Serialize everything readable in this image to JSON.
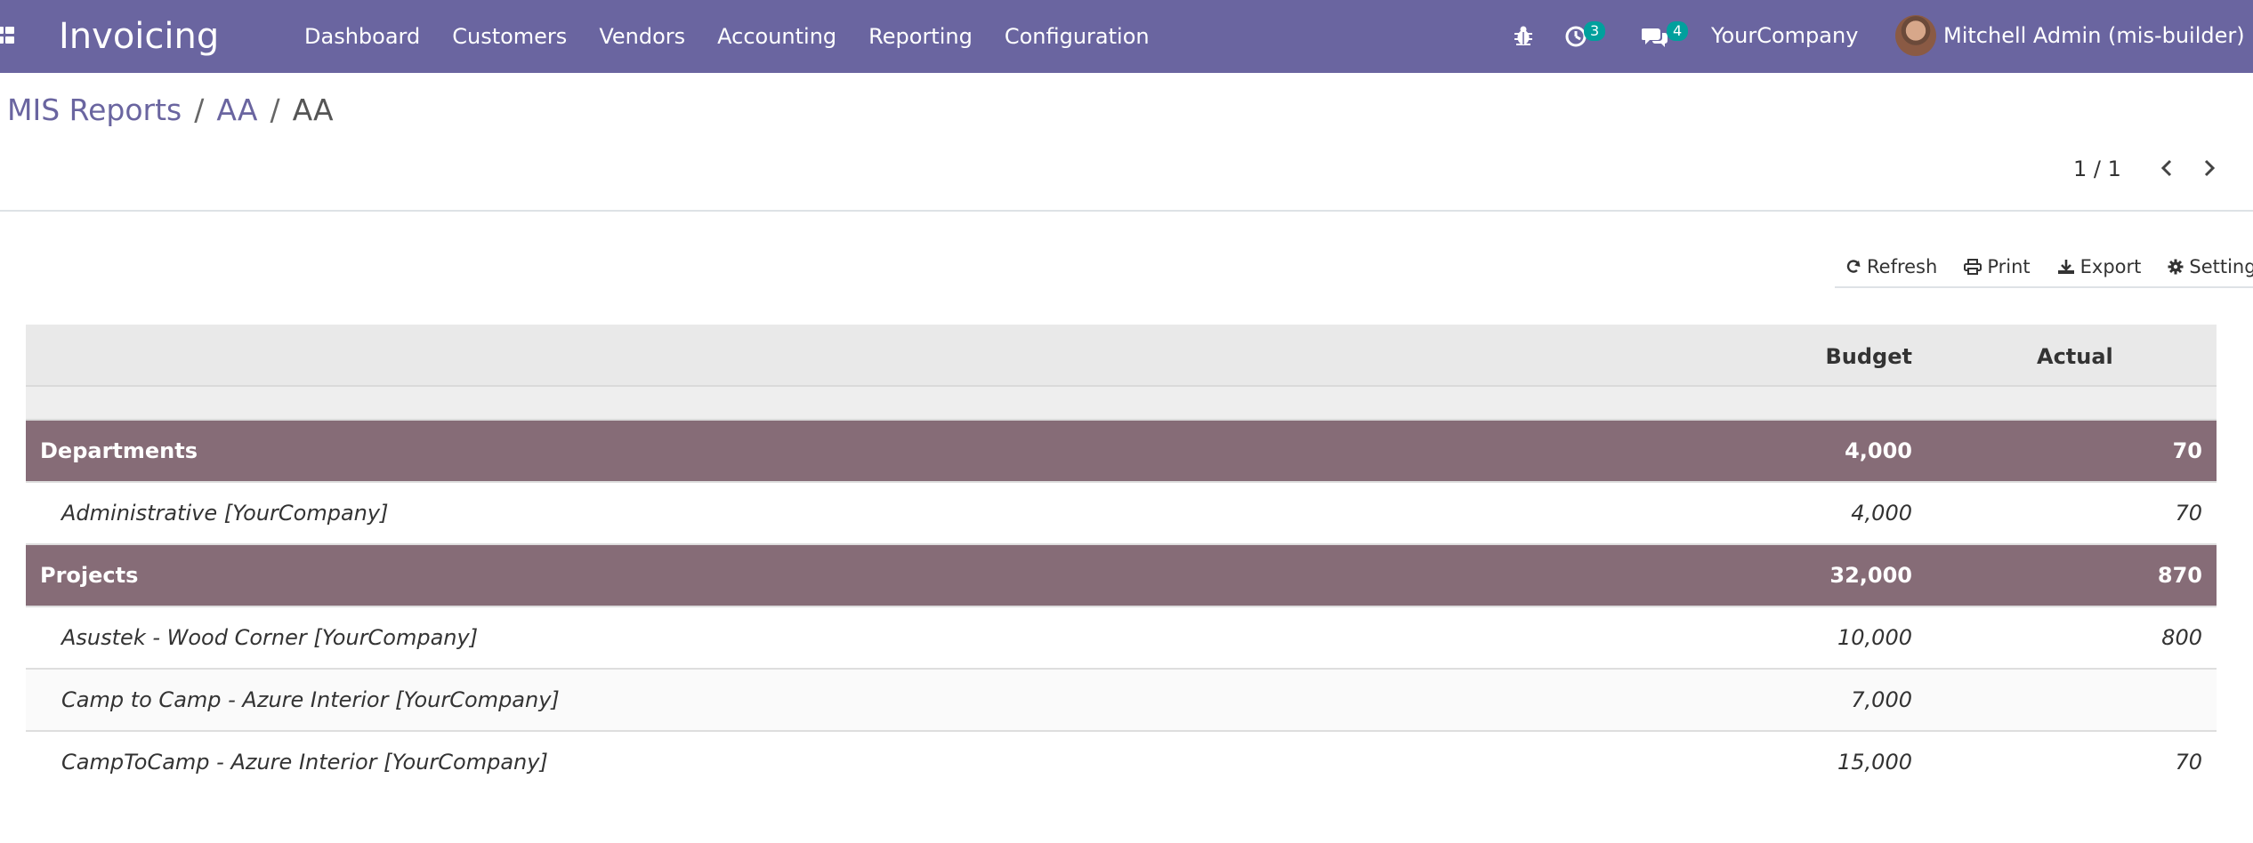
{
  "navbar": {
    "app_title": "Invoicing",
    "menu": [
      "Dashboard",
      "Customers",
      "Vendors",
      "Accounting",
      "Reporting",
      "Configuration"
    ],
    "activity_count": "3",
    "message_count": "4",
    "company": "YourCompany",
    "user": "Mitchell Admin (mis-builder)"
  },
  "breadcrumb": {
    "items": [
      "MIS Reports",
      "AA"
    ],
    "separator": "/",
    "current": "AA"
  },
  "pager": {
    "value": "1 / 1"
  },
  "toolbar": {
    "refresh": "Refresh",
    "print": "Print",
    "export": "Export",
    "settings": "Settings"
  },
  "table": {
    "columns": [
      "",
      "Budget",
      "Actual"
    ],
    "rows": [
      {
        "kind": "group",
        "label": "Departments",
        "budget": "4,000",
        "actual": "70"
      },
      {
        "kind": "detail",
        "label": "Administrative [YourCompany]",
        "budget": "4,000",
        "actual": "70"
      },
      {
        "kind": "group",
        "label": "Projects",
        "budget": "32,000",
        "actual": "870"
      },
      {
        "kind": "detail",
        "label": "Asustek - Wood Corner [YourCompany]",
        "budget": "10,000",
        "actual": "800"
      },
      {
        "kind": "detail",
        "label": "Camp to Camp - Azure Interior [YourCompany]",
        "budget": "7,000",
        "actual": ""
      },
      {
        "kind": "detail",
        "label": "CampToCamp - Azure Interior [YourCompany]",
        "budget": "15,000",
        "actual": "70"
      }
    ]
  },
  "colors": {
    "navbar": "#6a65a0",
    "group_row": "#866c77",
    "badge": "#00a09d",
    "link": "#6a65a0"
  }
}
